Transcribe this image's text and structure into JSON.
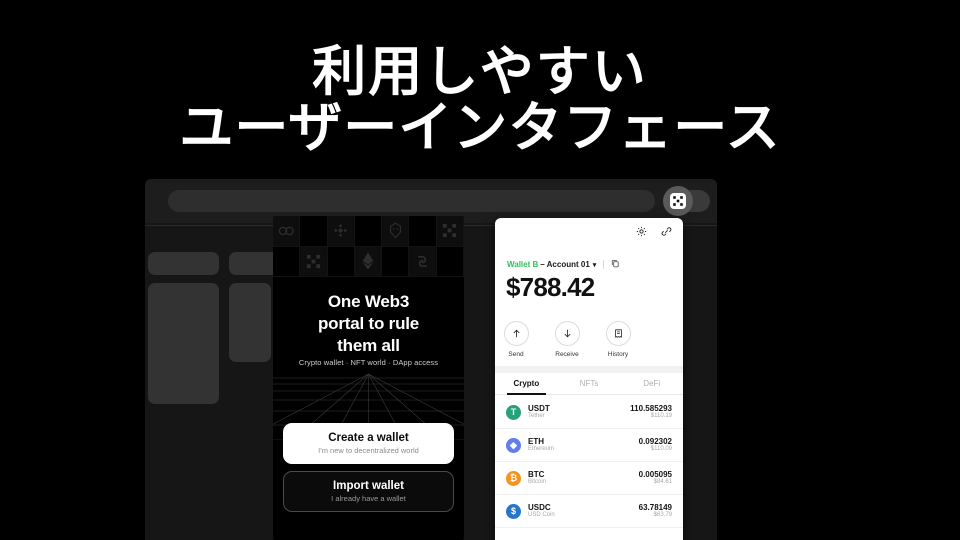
{
  "headline": {
    "line1": "利用しやすい",
    "line2": "ユーザーインタフェース"
  },
  "browser": {
    "url_value": "",
    "url_placeholder": "",
    "extension_icon": "wallet-extension-icon"
  },
  "promo": {
    "title_line1": "One Web3",
    "title_line2": "portal to rule",
    "title_line3": "them all",
    "subtitle": "Crypto wallet · NFT world · DApp access",
    "logos": [
      "chain-links-icon",
      "binance-diamond-icon",
      "avatar-head-icon",
      "dice-dots-icon",
      "dice-dots-icon",
      "ethereum-diamond-icon",
      "swap-arrows-icon"
    ],
    "primary_button": {
      "title": "Create a wallet",
      "subtitle": "I'm new to decentralized world"
    },
    "secondary_button": {
      "title": "Import wallet",
      "subtitle": "I already have a wallet"
    }
  },
  "wallet": {
    "settings_icon": "gear-icon",
    "connect_icon": "link-icon",
    "wallet_name": "Wallet B",
    "account_name": "– Account 01",
    "caret": "▾",
    "copy_icon": "copy-icon",
    "balance": "$788.42",
    "actions": [
      {
        "label": "Send",
        "icon": "arrow-up-icon"
      },
      {
        "label": "Receive",
        "icon": "arrow-down-icon"
      },
      {
        "label": "History",
        "icon": "document-icon"
      }
    ],
    "tabs": [
      {
        "label": "Crypto",
        "active": true
      },
      {
        "label": "NFTs",
        "active": false
      },
      {
        "label": "DeFi",
        "active": false
      }
    ],
    "tokens": [
      {
        "symbol": "USDT",
        "name": "Tether",
        "amount": "110.585293",
        "usd": "$110.19",
        "color": "#26A17B",
        "glyph": "T"
      },
      {
        "symbol": "ETH",
        "name": "Ethereum",
        "amount": "0.092302",
        "usd": "$110.09",
        "color": "#627EEA",
        "glyph": "◆"
      },
      {
        "symbol": "BTC",
        "name": "Bitcoin",
        "amount": "0.005095",
        "usd": "$84.61",
        "color": "#F7931A",
        "glyph": "₿"
      },
      {
        "symbol": "USDC",
        "name": "USD Coin",
        "amount": "63.78149",
        "usd": "$63.79",
        "color": "#2775CA",
        "glyph": "$"
      }
    ]
  },
  "colors": {
    "background": "#000000",
    "accent_green": "#2fbf5e",
    "panel": "#ffffff",
    "browser_chrome": "#1d1d1d"
  }
}
